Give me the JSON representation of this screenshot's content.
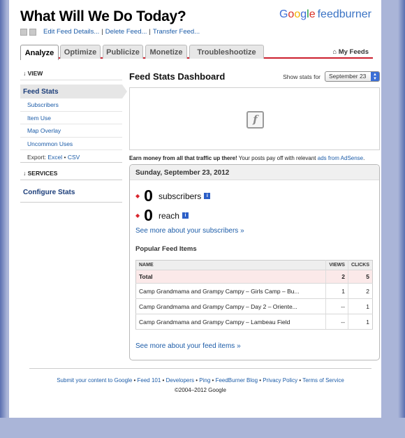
{
  "header": {
    "feed_title": "What Will We Do Today?",
    "brand_google": "Google",
    "brand_product": "feedburner",
    "links": [
      "Edit Feed Details...",
      "Delete Feed...",
      "Transfer Feed..."
    ]
  },
  "tabs": [
    "Analyze",
    "Optimize",
    "Publicize",
    "Monetize",
    "Troubleshootize"
  ],
  "my_feeds": "My Feeds",
  "sidebar": {
    "view_head": "↓ VIEW",
    "active_item": "Feed Stats",
    "items": [
      "Subscribers",
      "Item Use",
      "Map Overlay",
      "Uncommon Uses"
    ],
    "export_label": "Export:",
    "export_excel": "Excel",
    "export_sep": "•",
    "export_csv": "CSV",
    "services_head": "↓ SERVICES",
    "configure": "Configure Stats"
  },
  "main": {
    "title": "Feed Stats Dashboard",
    "show_stats_label": "Show stats for",
    "date_select": "September 23",
    "flash_glyph": "f",
    "adsense_bold": "Earn money from all that traffic up there!",
    "adsense_text": " Your posts pay off with relevant ",
    "adsense_link": "ads from AdSense",
    "adsense_end": ".",
    "stats_date": "Sunday, September 23, 2012",
    "subscribers_num": "0",
    "subscribers_label": "subscribers",
    "reach_num": "0",
    "reach_label": "reach",
    "info_glyph": "i",
    "see_more_subscribers": "See more about your subscribers »",
    "popular_head": "Popular Feed Items",
    "table": {
      "headers": [
        "NAME",
        "VIEWS",
        "CLICKS"
      ],
      "total": {
        "name": "Total",
        "views": "2",
        "clicks": "5"
      },
      "rows": [
        {
          "name": "Camp Grandmama and Grampy Campy – Girls Camp – Bu...",
          "views": "1",
          "clicks": "2"
        },
        {
          "name": "Camp Grandmama and Grampy Campy – Day 2 – Oriente...",
          "views": "--",
          "clicks": "1"
        },
        {
          "name": "Camp Grandmama and Grampy Campy – Lambeau Field",
          "views": "--",
          "clicks": "1"
        }
      ]
    },
    "see_more_items": "See more about your feed items »"
  },
  "footer": {
    "links": [
      "Submit your content to Google",
      "Feed 101",
      "Developers",
      "Ping",
      "FeedBurner Blog",
      "Privacy Policy",
      "Terms of Service"
    ],
    "copyright": "©2004–2012 Google"
  },
  "colors": {
    "accent_red": "#cc1f2e",
    "link_blue": "#1c5ca8",
    "info_blue": "#2c5fc7"
  }
}
